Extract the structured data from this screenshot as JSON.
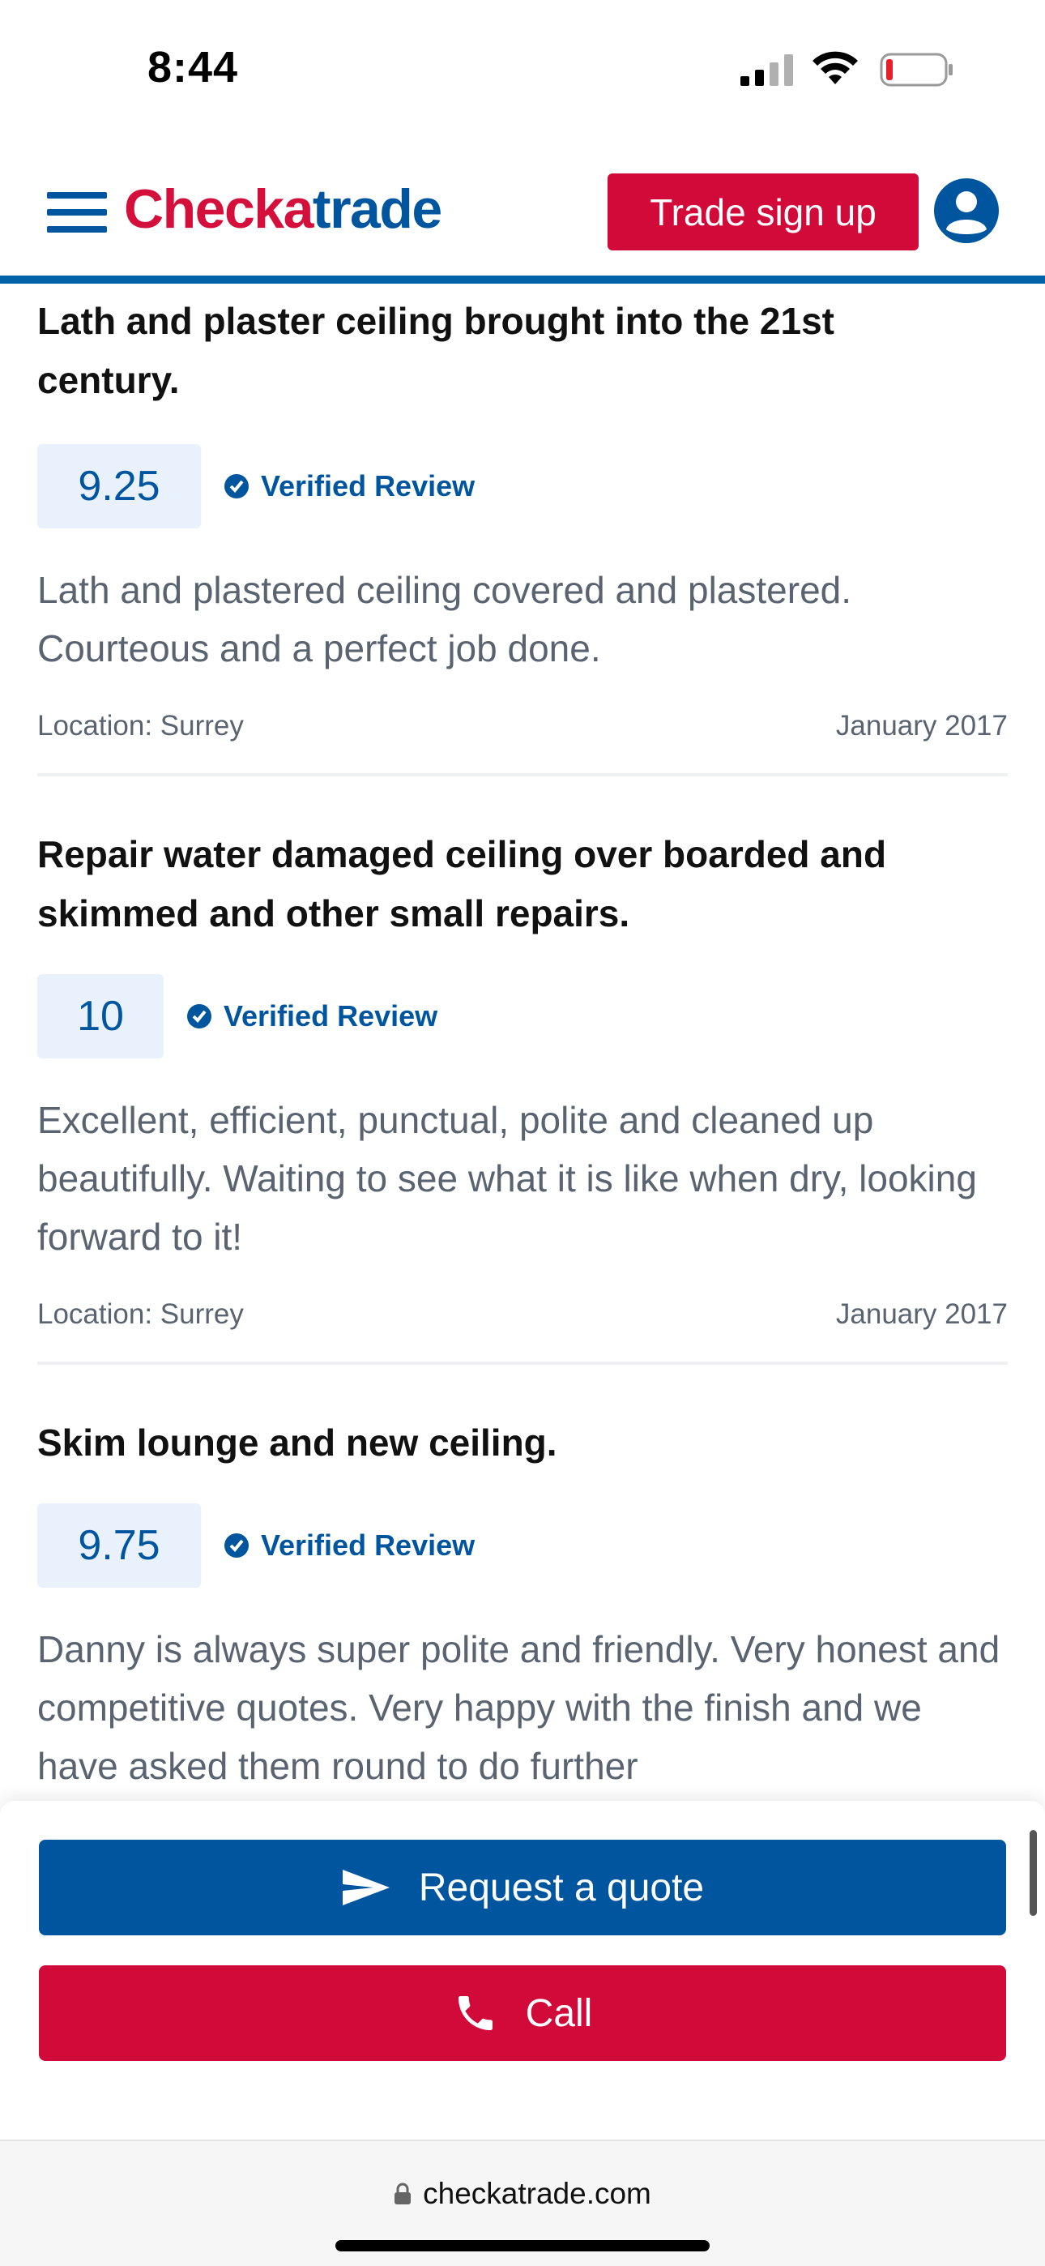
{
  "status_bar": {
    "time": "8:44"
  },
  "header": {
    "logo_part1": "Checka",
    "logo_part2": "trade",
    "trade_signup_label": "Trade sign up"
  },
  "reviews": [
    {
      "title": "Lath and plaster ceiling brought into the 21st century.",
      "score": "9.25",
      "verified_label": "Verified Review",
      "body": "Lath and plastered ceiling covered and plastered. Courteous and a perfect job done.",
      "location": "Location: Surrey",
      "date": "January 2017"
    },
    {
      "title": "Repair water damaged ceiling over boarded and skimmed and other small repairs.",
      "score": "10",
      "verified_label": "Verified Review",
      "body": "Excellent, efficient, punctual, polite and cleaned up beautifully. Waiting to see what it is like when dry, looking forward to it!",
      "location": "Location: Surrey",
      "date": "January 2017"
    },
    {
      "title": "Skim lounge and new ceiling.",
      "score": "9.75",
      "verified_label": "Verified Review",
      "body": "Danny is always super polite and friendly. Very honest and competitive quotes. Very happy with the finish and we have asked them round to do further"
    }
  ],
  "actions": {
    "request_quote_label": "Request a quote",
    "call_label": "Call"
  },
  "browser": {
    "url": "checkatrade.com"
  },
  "colors": {
    "brand_blue": "#00559f",
    "brand_red": "#d10a3a",
    "score_bg": "#e9f2fc"
  }
}
